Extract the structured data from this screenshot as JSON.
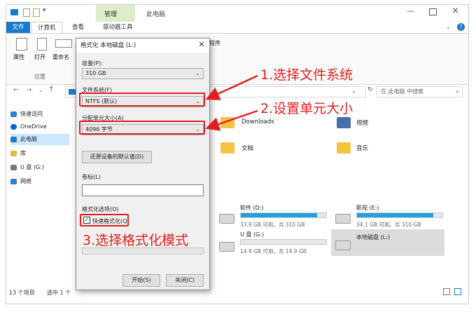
{
  "explorer": {
    "title": "此电脑",
    "context_tab": "管理",
    "tabs": [
      "文件",
      "计算机",
      "查看",
      "驱动器工具"
    ],
    "ribbon_buttons": [
      "属性",
      "打开",
      "重命名"
    ],
    "ribbon_group": "位置",
    "ribbon_extra": "程序",
    "search_placeholder": "在 此电脑 中搜索",
    "nav": [
      "快速访问",
      "OneDrive",
      "此电脑",
      "库",
      "U 盘 (G:)",
      "网络"
    ],
    "folders": [
      "Downloads",
      "视频",
      "文档",
      "音乐"
    ],
    "drives": [
      {
        "name": "软件 (D:)",
        "info": "33.9 GB 可用，共 310 GB",
        "used": 0.89
      },
      {
        "name": "影视 (E:)",
        "info": "34.1 GB 可用，共 310 GB",
        "used": 0.89
      },
      {
        "name": "U 盘 (G:)",
        "info": "14.9 GB 可用，共 14.9 GB",
        "used": 0.0
      },
      {
        "name": "本地磁盘 (L:)",
        "info": "",
        "used": null
      }
    ],
    "status_left": "13 个项目",
    "status_sel": "选中 1 个"
  },
  "dialog": {
    "title": "格式化 本地磁盘 (L:)",
    "capacity_label": "容量(P):",
    "capacity_value": "310 GB",
    "fs_label": "文件系统(F)",
    "fs_value": "NTFS (默认)",
    "alloc_label": "分配单元大小(A)",
    "alloc_value": "4096 字节",
    "restore_button": "还原设备的默认值(D)",
    "volume_label": "卷标(L)",
    "volume_value": "",
    "options_label": "格式化选项(O)",
    "quick_format": "快速格式化(Q)",
    "quick_checked": true,
    "start_button": "开始(S)",
    "close_button": "关闭(C)"
  },
  "annotations": [
    "1.选择文件系统",
    "2.设置单元大小",
    "3.选择格式化模式"
  ],
  "colors": {
    "annotation": "#e02020",
    "accent": "#1979ca",
    "context": "#dcedc8"
  }
}
